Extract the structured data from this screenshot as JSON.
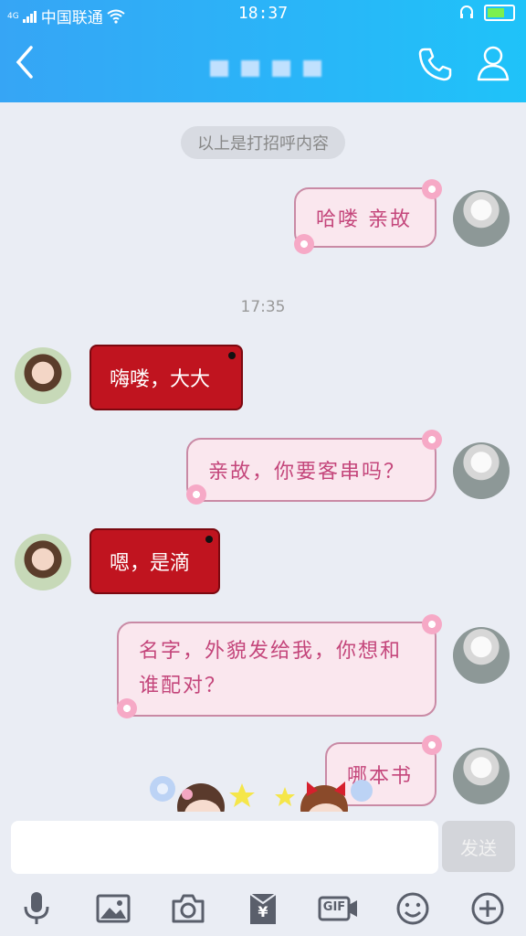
{
  "status": {
    "carrier": "中国联通",
    "net": "4G",
    "time": "18:37"
  },
  "header": {
    "contact_name": ""
  },
  "system_note": "以上是打招呼内容",
  "timestamp": "17:35",
  "messages": [
    {
      "side": "me",
      "text": "哈喽 亲故"
    },
    {
      "side": "her",
      "text": "嗨喽，大大"
    },
    {
      "side": "me",
      "text": "亲故，你要客串吗？"
    },
    {
      "side": "her",
      "text": "嗯，是滴"
    },
    {
      "side": "me",
      "text": "名字，外貌发给我，你想和谁配对？"
    },
    {
      "side": "me",
      "text": "哪本书"
    }
  ],
  "input": {
    "placeholder": "",
    "send_label": "发送"
  },
  "toolbar": {
    "gif_label": "GIF",
    "red_packet_label": "¥"
  },
  "colors": {
    "header": "#29b6f8",
    "bubble_me_bg": "#fae7ee",
    "bubble_me_text": "#c4467b",
    "bubble_her_bg": "#c0141f"
  }
}
